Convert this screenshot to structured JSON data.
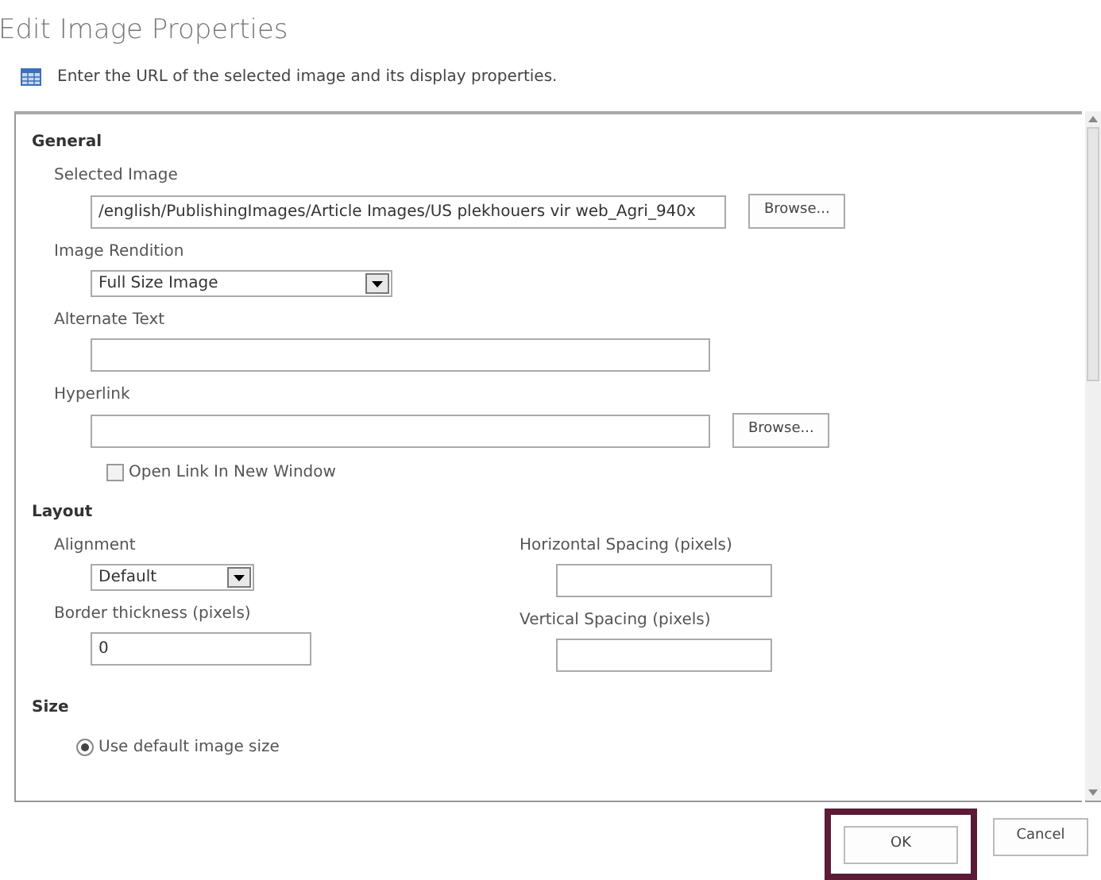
{
  "dialog": {
    "title": "Edit Image Properties",
    "instruction": "Enter the URL of the selected image and its display properties."
  },
  "sections": [
    {
      "heading": "General",
      "fields": [
        {
          "kind": "text",
          "label": "Selected Image",
          "value": "/english/PublishingImages/Article Images/US plekhouers vir web_Agri_940x",
          "button": "Browse..."
        },
        {
          "kind": "select",
          "label": "Image Rendition",
          "value": "Full Size Image"
        },
        {
          "kind": "text",
          "label": "Alternate Text"
        },
        {
          "kind": "text",
          "label": "Hyperlink",
          "button": "Browse..."
        },
        {
          "kind": "checkbox",
          "label": "Open Link In New Window",
          "checked": false
        }
      ]
    },
    {
      "heading": "Layout",
      "columns": [
        [
          {
            "kind": "select",
            "label": "Alignment",
            "value": "Default"
          },
          {
            "kind": "text",
            "label": "Border thickness (pixels)",
            "value": "0"
          }
        ],
        [
          {
            "kind": "text",
            "label": "Horizontal Spacing (pixels)"
          },
          {
            "kind": "text",
            "label": "Vertical Spacing (pixels)"
          }
        ]
      ]
    },
    {
      "heading": "Size",
      "fields": [
        {
          "kind": "radio",
          "label": "Use default image size",
          "selected": true
        }
      ]
    }
  ],
  "buttons": [
    {
      "label": "OK",
      "highlighted": true
    },
    {
      "label": "Cancel",
      "highlighted": false
    }
  ]
}
